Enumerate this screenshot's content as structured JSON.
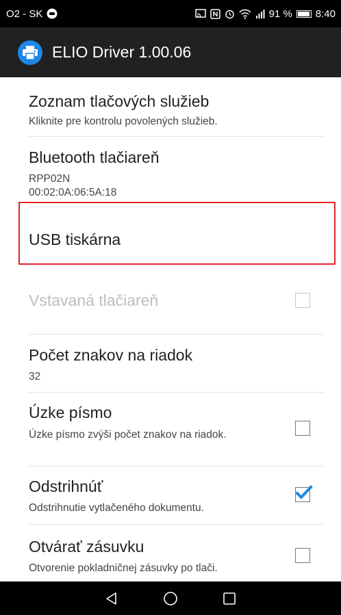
{
  "status_bar": {
    "carrier": "O2 - SK",
    "battery": "91 %",
    "time": "8:40",
    "icons": [
      "cast-icon",
      "nfc-icon",
      "alarm-icon",
      "wifi-icon",
      "signal-icon",
      "battery-icon"
    ]
  },
  "app_bar": {
    "title": "ELIO Driver 1.00.06",
    "icon": "printer-icon",
    "accent_color": "#1e88e5"
  },
  "preferences": [
    {
      "title": "Zoznam tlačových služieb",
      "summary": "Kliknite pre kontrolu povolených služieb.",
      "enabled": true
    },
    {
      "title": "Bluetooth tlačiareň",
      "summary_lines": [
        "RPP02N",
        "00:02:0A:06:5A:18"
      ],
      "enabled": true
    },
    {
      "title": "USB tiskárna",
      "enabled": true,
      "highlighted": true,
      "highlight_color": "#e1262a"
    },
    {
      "title": "Vstavaná tlačiareň",
      "enabled": false,
      "checkbox": true,
      "checked": false
    },
    {
      "title": "Počet znakov na riadok",
      "summary": "32",
      "enabled": true
    },
    {
      "title": "Úzke písmo",
      "summary": "Úzke písmo zvýši počet znakov na riadok.",
      "enabled": true,
      "checkbox": true,
      "checked": false
    },
    {
      "title": "Odstrihnúť",
      "summary": "Odstrihnutie vytlačeného dokumentu.",
      "enabled": true,
      "checkbox": true,
      "checked": true,
      "check_color": "#1e88e5"
    },
    {
      "title": "Otvárať zásuvku",
      "summary": "Otvorenie pokladničnej zásuvky po tlači.",
      "enabled": true,
      "checkbox": true,
      "checked": false
    }
  ],
  "nav_bar": {
    "buttons": [
      "back-icon",
      "home-icon",
      "recents-icon"
    ]
  }
}
